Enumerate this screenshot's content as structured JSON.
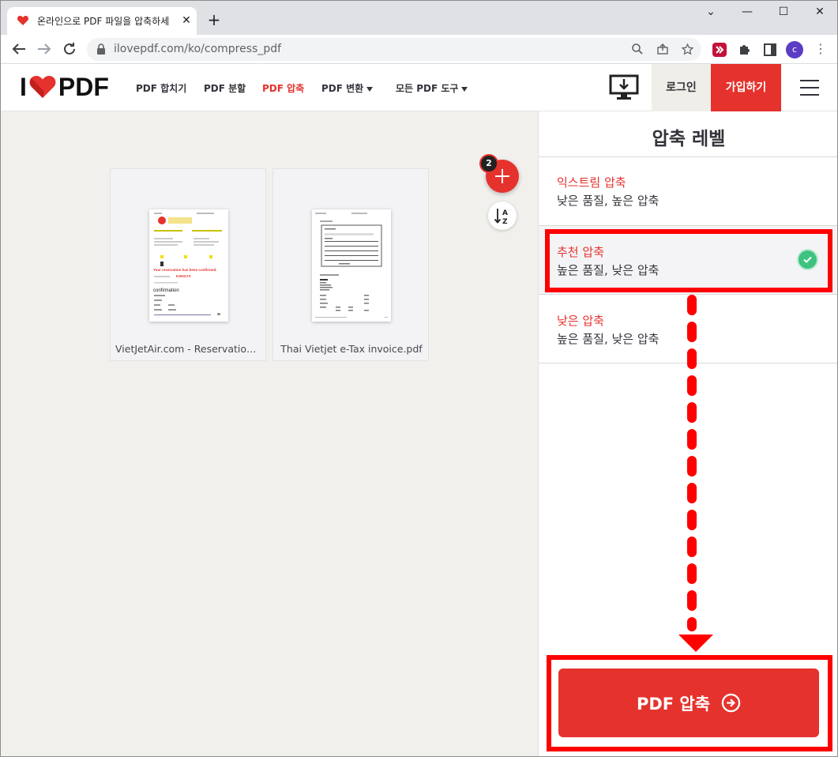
{
  "browser": {
    "tab_title": "온라인으로 PDF 파일을 압축하세",
    "tab_close": "✕",
    "new_tab": "+",
    "url": "ilovepdf.com/ko/compress_pdf",
    "profile_initial": "c",
    "window_controls": [
      "⌄",
      "—",
      "☐",
      "✕"
    ]
  },
  "header": {
    "logo_left": "I",
    "logo_right": "PDF",
    "nav": [
      {
        "label": "PDF 합치기"
      },
      {
        "label": "PDF 분할"
      },
      {
        "label": "PDF 압축"
      },
      {
        "label": "PDF 변환"
      },
      {
        "label": "모든 PDF 도구"
      }
    ],
    "login": "로그인",
    "signup": "가입하기"
  },
  "workspace": {
    "file_count": "2",
    "files": [
      {
        "name": "VietJetAir.com - Reservation Confirmation.pdf"
      },
      {
        "name": "Thai Vietjet e-Tax invoice.pdf"
      }
    ],
    "thumb1_headline": "Your reservation has been confirmed.",
    "thumb1_code": "KSHG7X",
    "thumb1_big": "confirmation"
  },
  "panel": {
    "title": "압축 레벨",
    "options": [
      {
        "title": "익스트림 압축",
        "desc": "낮은 품질, 높은 압축"
      },
      {
        "title": "추천 압축",
        "desc": "높은 품질, 낮은 압축"
      },
      {
        "title": "낮은 압축",
        "desc": "높은 품질, 낮은 압축"
      }
    ],
    "selected_index": 1,
    "compress_button": "PDF 압축"
  },
  "colors": {
    "brand": "#e5322d",
    "annotation": "#ff0000",
    "check": "#3ec27f"
  }
}
